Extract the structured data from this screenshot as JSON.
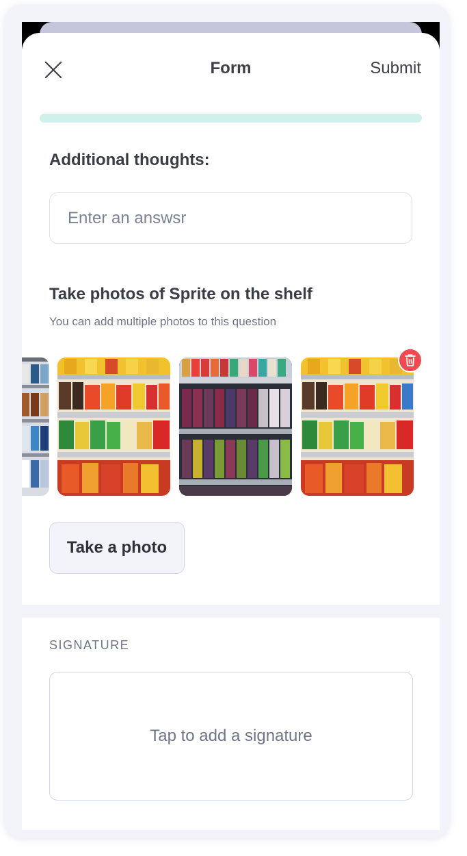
{
  "header": {
    "title": "Form",
    "submit_label": "Submit",
    "close_icon": "close-icon"
  },
  "progress": {
    "value": 1.0,
    "color": "#d0f0ec"
  },
  "questions": {
    "thoughts": {
      "label": "Additional thoughts:",
      "placeholder": "Enter an answsr",
      "value": ""
    },
    "photos": {
      "label": "Take photos of Sprite on the shelf",
      "hint": "You can add multiple photos to this question",
      "count_visible": 4,
      "delete_icon": "trash-icon",
      "take_photo_label": "Take a photo"
    }
  },
  "signature": {
    "section_label": "SIGNATURE",
    "prompt": "Tap to add a signature"
  },
  "colors": {
    "accent_delete": "#ef4a4f",
    "text_dark": "#3a3d46",
    "text_muted": "#6d7586"
  }
}
